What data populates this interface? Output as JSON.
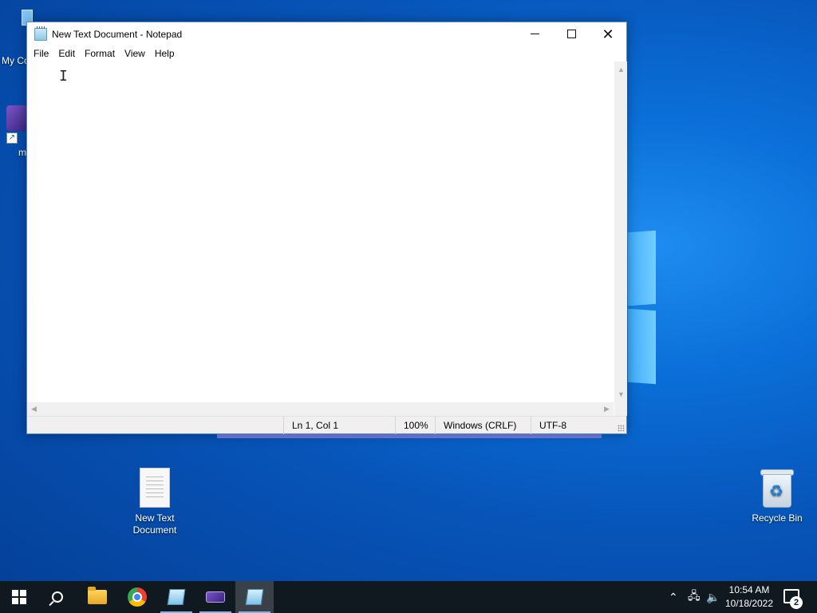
{
  "desktop": {
    "icons": [
      {
        "label": "New Text\nDocument"
      },
      {
        "label": "Recycle Bin"
      }
    ],
    "partial_labels": {
      "my_computer": "My Co",
      "app": "m"
    }
  },
  "notepad": {
    "title": "New Text Document - Notepad",
    "menu": [
      "File",
      "Edit",
      "Format",
      "View",
      "Help"
    ],
    "content": "",
    "status": {
      "position": "Ln 1, Col 1",
      "zoom": "100%",
      "line_endings": "Windows (CRLF)",
      "encoding": "UTF-8"
    }
  },
  "taskbar": {
    "clock_time": "10:54 AM",
    "clock_date": "10/18/2022",
    "notification_count": "2"
  }
}
